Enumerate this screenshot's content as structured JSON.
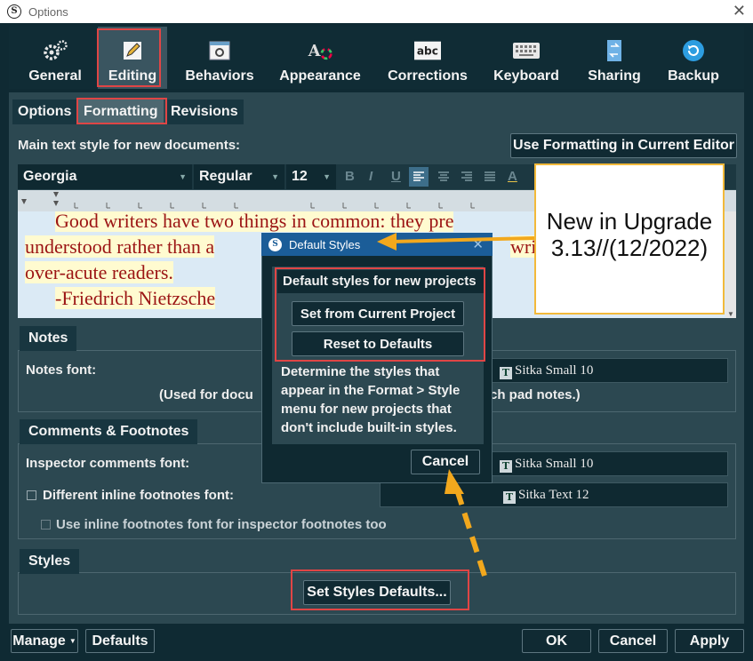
{
  "window": {
    "title": "Options",
    "close_glyph": "✕"
  },
  "toolbar": {
    "items": [
      {
        "label": "General",
        "icon": "gear-icon"
      },
      {
        "label": "Editing",
        "icon": "pencil-icon"
      },
      {
        "label": "Behaviors",
        "icon": "window-gear-icon"
      },
      {
        "label": "Appearance",
        "icon": "font-color-icon"
      },
      {
        "label": "Corrections",
        "icon": "abc-icon"
      },
      {
        "label": "Keyboard",
        "icon": "keyboard-icon"
      },
      {
        "label": "Sharing",
        "icon": "sharing-icon"
      },
      {
        "label": "Backup",
        "icon": "backup-icon"
      }
    ],
    "active": "Editing",
    "abc_text": "abc"
  },
  "subtabs": {
    "options": "Options",
    "formatting": "Formatting",
    "revisions": "Revisions"
  },
  "main_style": {
    "label": "Main text style for new documents:",
    "use_current_button": "Use Formatting in Current Editor",
    "font_family": "Georgia",
    "font_style": "Regular",
    "font_size": "12",
    "bold": "B",
    "italic": "I",
    "underline": "U",
    "font_color": "A"
  },
  "sample_text": {
    "line1": "Good writers have two things in common: they pre",
    "line2": "understood rather than a",
    "line2b": "writ",
    "line3": "over-acute readers.",
    "line4": "-Friedrich Nietzsche"
  },
  "notes": {
    "tab": "Notes",
    "font_label": "Notes font:",
    "font_value": "Sitka Small 10",
    "hint_left": "(Used for docu",
    "hint_right": "tch pad notes.)"
  },
  "comments": {
    "tab": "Comments & Footnotes",
    "inspector_label": "Inspector comments font:",
    "inspector_font": "Sitka Small 10",
    "inline_label": "Different inline footnotes font:",
    "inline_font": "Sitka Text 12",
    "use_inline_label": "Use inline footnotes font for inspector footnotes too"
  },
  "styles": {
    "tab": "Styles",
    "set_defaults_button": "Set Styles Defaults..."
  },
  "bottom": {
    "manage": "Manage",
    "defaults": "Defaults",
    "ok": "OK",
    "cancel": "Cancel",
    "apply": "Apply"
  },
  "dialog": {
    "title": "Default Styles",
    "heading": "Default styles for new projects",
    "set_from_current": "Set from Current Project",
    "reset": "Reset to Defaults",
    "description": "Determine the styles that appear in the Format > Style menu for new projects that don't include built-in styles.",
    "cancel": "Cancel"
  },
  "annotation": {
    "callout_line1": "New in Upgrade",
    "callout_line2": "3.13//(12/2022)",
    "colors": {
      "highlight_box": "#e04545",
      "arrow": "#f2a81d"
    }
  }
}
